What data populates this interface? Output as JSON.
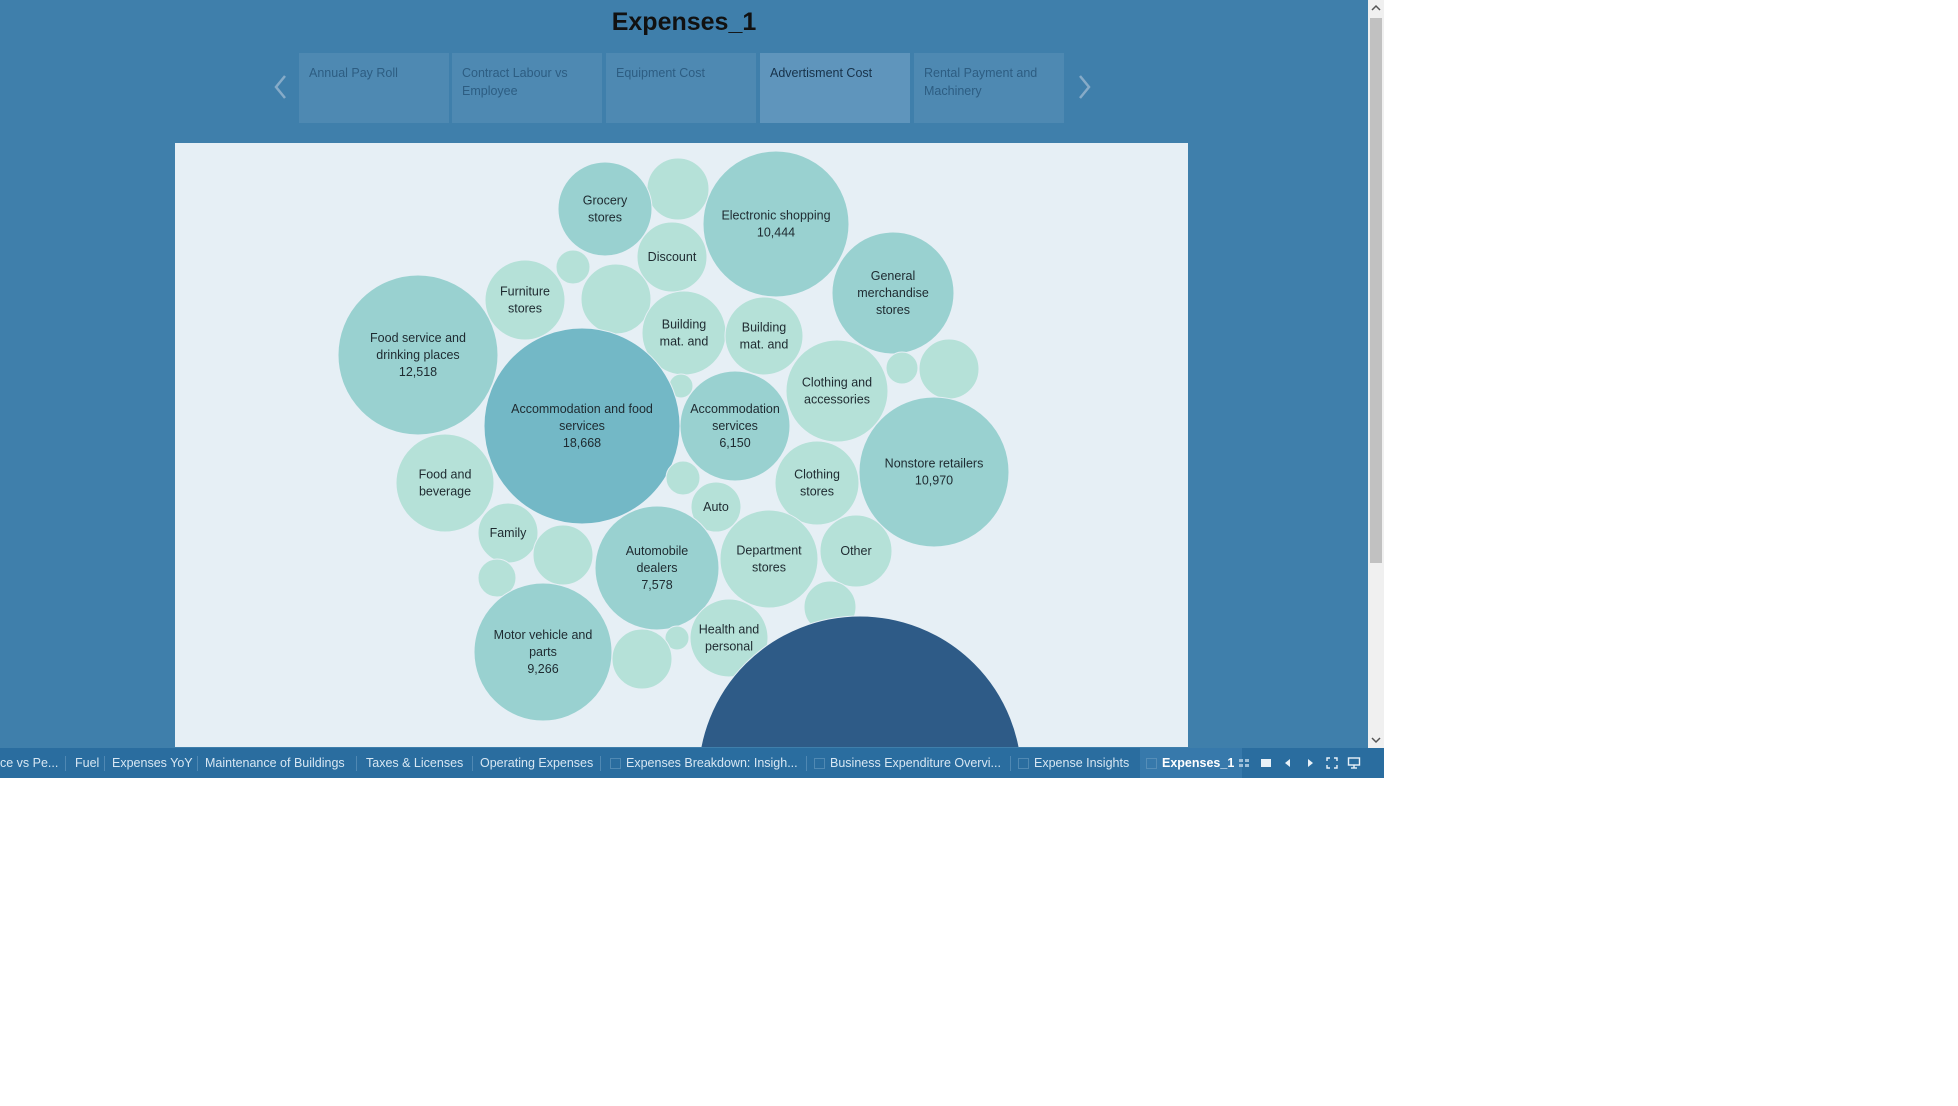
{
  "dashboard": {
    "title": "Expenses_1"
  },
  "story": {
    "points": [
      {
        "label": "Annual Pay Roll",
        "active": false
      },
      {
        "label": "Contract Labour vs Employee",
        "active": false
      },
      {
        "label": "Equipment Cost",
        "active": false
      },
      {
        "label": "Advertisment Cost",
        "active": true
      },
      {
        "label": "Rental Payment and Machinery",
        "active": false
      }
    ]
  },
  "chart_data": {
    "type": "bubble",
    "bubbles": [
      {
        "label": "Accommodation and food services",
        "value": 18668
      },
      {
        "label": "Food service and drinking places",
        "value": 12518
      },
      {
        "label": "Nonstore retailers",
        "value": 10970
      },
      {
        "label": "Electronic shopping",
        "value": 10444
      },
      {
        "label": "Motor vehicle and parts",
        "value": 9266
      },
      {
        "label": "Automobile dealers",
        "value": 7578
      },
      {
        "label": "Accommodation services",
        "value": 6150
      },
      {
        "label": "General merchandise stores",
        "value": null
      },
      {
        "label": "Department stores",
        "value": null
      },
      {
        "label": "Clothing and accessories",
        "value": null
      },
      {
        "label": "Food and beverage",
        "value": null
      },
      {
        "label": "Grocery stores",
        "value": null
      },
      {
        "label": "Furniture stores",
        "value": null
      },
      {
        "label": "Clothing stores",
        "value": null
      },
      {
        "label": "Building mat. and",
        "value": null
      },
      {
        "label": "Building mat. and",
        "value": null
      },
      {
        "label": "Health and personal",
        "value": null
      },
      {
        "label": "Discount",
        "value": null
      },
      {
        "label": "Family",
        "value": null
      },
      {
        "label": "Other",
        "value": null
      },
      {
        "label": "Auto",
        "value": null
      }
    ],
    "colors": {
      "dark": "#2e5b87",
      "medium": "#73b8c6",
      "light": "#99d1d0",
      "pale": "#b5e1d8",
      "background": "#e6eff5"
    }
  },
  "sheets": {
    "tabs": [
      {
        "label": "ce vs Pe...",
        "active": false,
        "icon": false
      },
      {
        "label": "Fuel",
        "active": false,
        "icon": false
      },
      {
        "label": "Expenses YoY",
        "active": false,
        "icon": false
      },
      {
        "label": "Maintenance of Buildings",
        "active": false,
        "icon": false
      },
      {
        "label": "Taxes & Licenses",
        "active": false,
        "icon": false
      },
      {
        "label": "Operating Expenses",
        "active": false,
        "icon": false
      },
      {
        "label": "Expenses Breakdown: Insigh...",
        "active": false,
        "icon": true
      },
      {
        "label": "Business Expenditure Overvi...",
        "active": false,
        "icon": true
      },
      {
        "label": "Expense Insights",
        "active": false,
        "icon": true
      },
      {
        "label": "Expenses_1",
        "active": true,
        "icon": true
      }
    ],
    "controls": [
      "grid-view-icon",
      "filmstrip-view-icon",
      "previous-sheet-icon",
      "next-sheet-icon",
      "fit-to-window-icon",
      "presentation-mode-icon"
    ]
  }
}
